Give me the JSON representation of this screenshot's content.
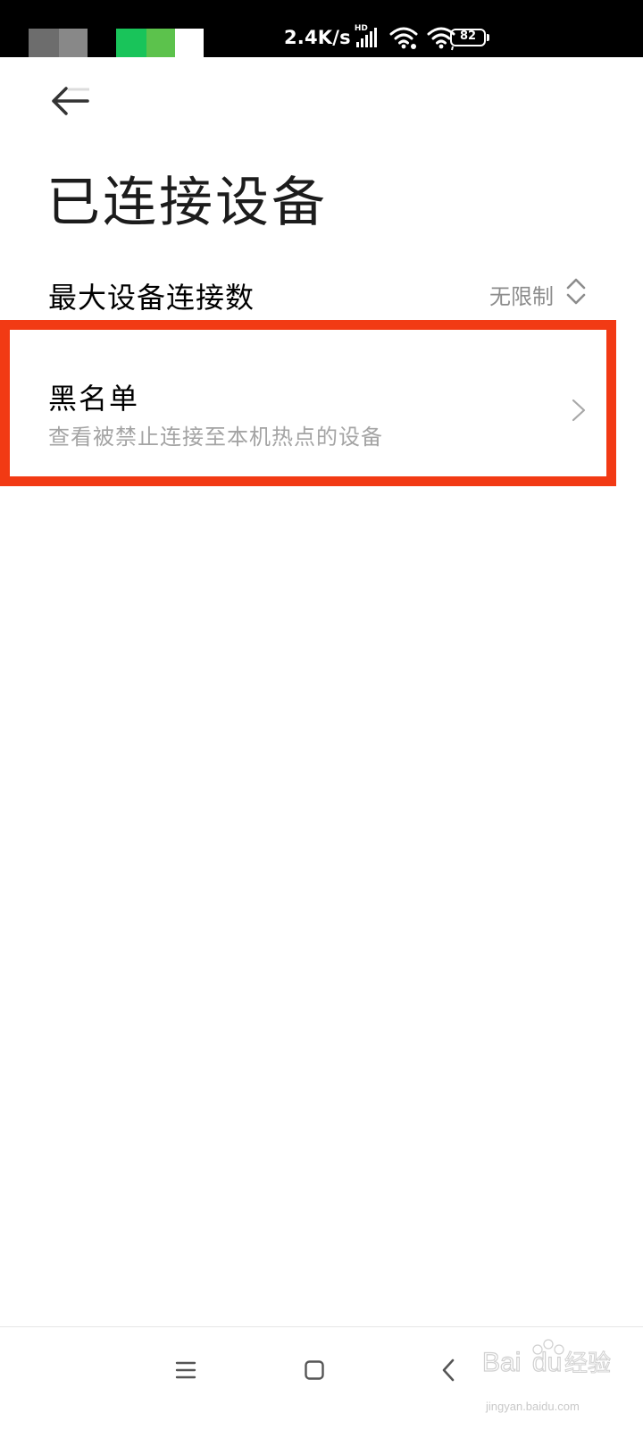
{
  "status_bar": {
    "network_speed": "2.4K/s",
    "signal_badge": "HD",
    "battery_level": "82",
    "icons": [
      "signal-icon",
      "wifi-icon",
      "hotspot-icon",
      "battery-icon"
    ],
    "colors": {
      "background": "#000000",
      "foreground": "#ffffff"
    }
  },
  "header": {
    "back_icon": "back-arrow-icon",
    "title": "已连接设备"
  },
  "settings": {
    "max_devices": {
      "label": "最大设备连接数",
      "value": "无限制",
      "icon": "updown-chevron-icon"
    },
    "blacklist": {
      "title": "黑名单",
      "subtitle": "查看被禁止连接至本机热点的设备",
      "icon": "chevron-right-icon",
      "highlight_color": "#f23a14"
    }
  },
  "nav_bar": {
    "buttons": [
      "menu-icon",
      "home-icon",
      "back-icon"
    ]
  },
  "watermark": {
    "brand": "Baidu经验",
    "url": "jingyan.baidu.com"
  }
}
